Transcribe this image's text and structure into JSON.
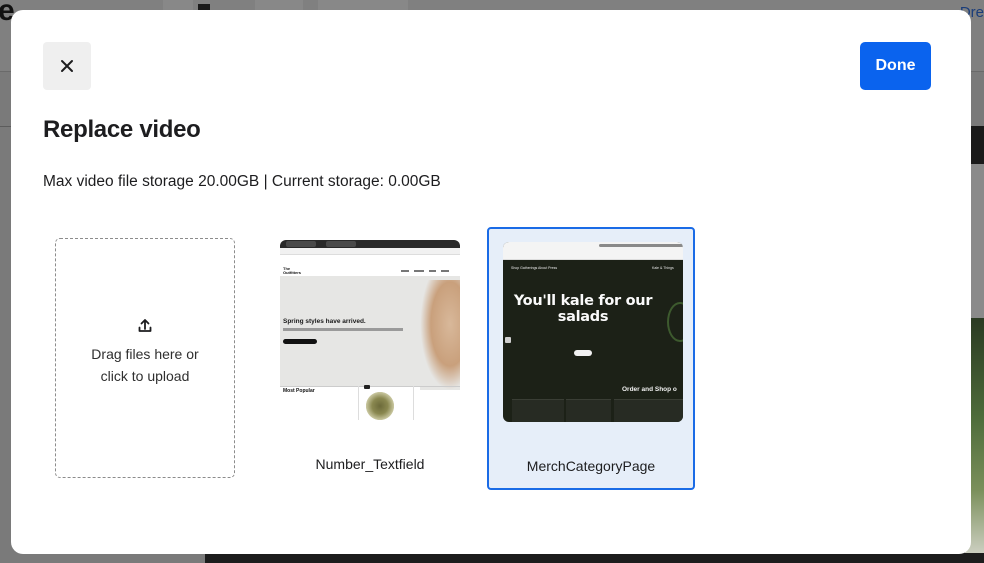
{
  "background": {
    "top_text": "e",
    "top_right_text": "Dre"
  },
  "modal": {
    "close_label": "Close",
    "done_label": "Done",
    "title": "Replace video",
    "storage_text": "Max video file storage 20.00GB | Current storage: 0.00GB",
    "upload": {
      "icon": "upload-icon",
      "text": "Drag files here or click to upload"
    },
    "videos": [
      {
        "name": "Number_Textfield",
        "selected": false
      },
      {
        "name": "MerchCategoryPage",
        "selected": true
      }
    ]
  },
  "thumbnails": {
    "t1": {
      "logo": "The Outfitters",
      "headline": "Spring styles have arrived.",
      "section": "Most Popular"
    },
    "t2": {
      "nav_left": "Shop   Gatherings   About   Press",
      "nav_right": "Kale & Things",
      "headline": "You'll kale for our salads",
      "order_text": "Order and Shop o"
    }
  },
  "colors": {
    "accent": "#0a63ee",
    "selected_bg": "#e6eef9",
    "selected_border": "#1a6be6"
  }
}
